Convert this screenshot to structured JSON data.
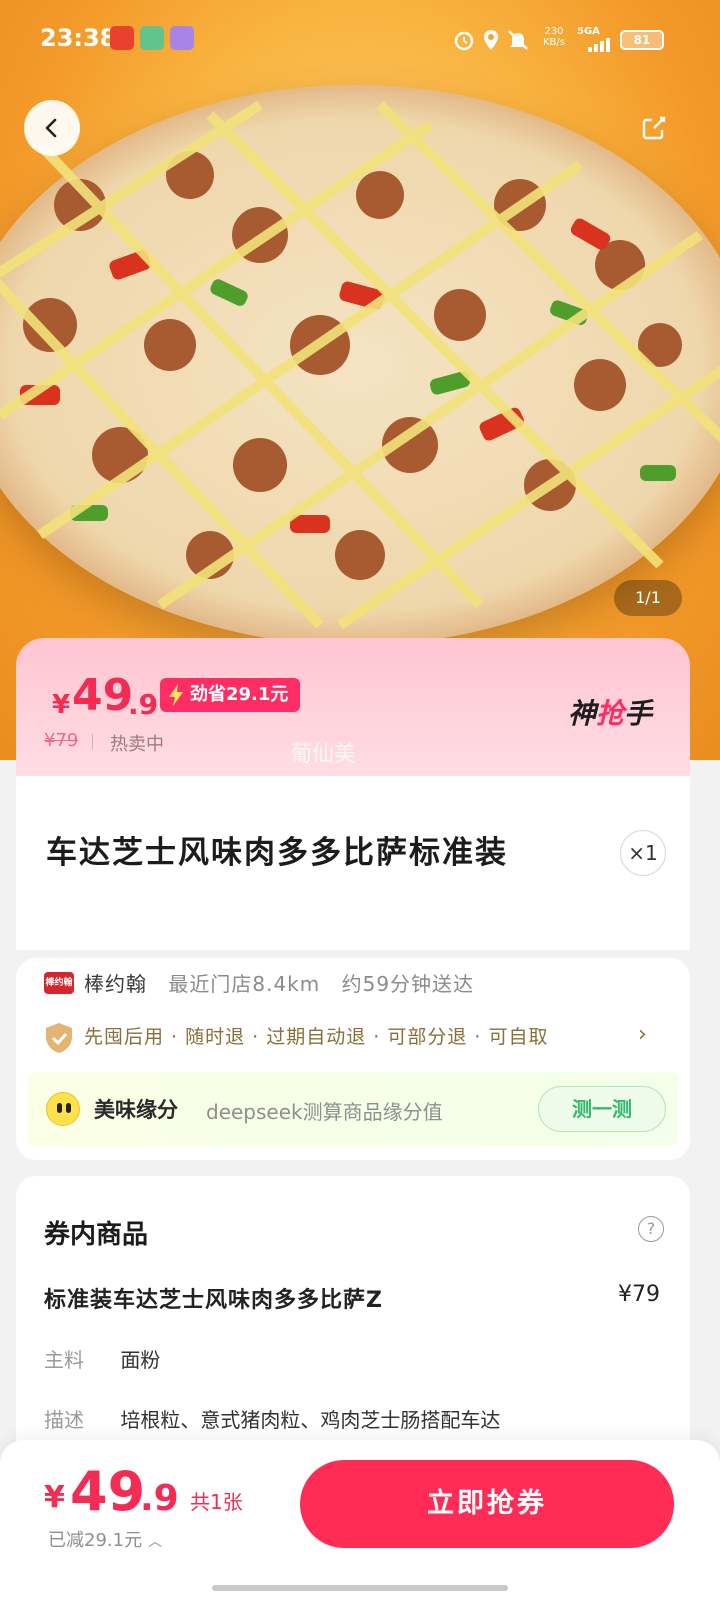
{
  "status_bar": {
    "time": "23:38",
    "net_speed": "230",
    "net_unit": "KB/s",
    "signal": "5GA",
    "battery": "81"
  },
  "hero": {
    "pager": "1/1"
  },
  "price": {
    "currency": "¥",
    "int": "49",
    "dec": ".9",
    "drop_label": "劲省29.1元",
    "original": "¥79",
    "hot": "热卖中",
    "brand_a": "神",
    "brand_b": "抢",
    "brand_c": "手",
    "watermark": "葡仙美"
  },
  "product": {
    "title": "车达芝士风味肉多多比萨标准装",
    "qty": "×1"
  },
  "store": {
    "logo": "棒约翰",
    "name": "棒约翰",
    "nearest": "最近门店8.4km",
    "delivery": "约59分钟送达",
    "policy": "先囤后用 · 随时退 · 过期自动退 · 可部分退 · 可自取"
  },
  "match": {
    "title": "美味缘分",
    "desc": "deepseek测算商品缘分值",
    "button": "测一测"
  },
  "goods": {
    "title": "券内商品",
    "help": "?",
    "item_name": "标准装车达芝士风味肉多多比萨Z",
    "item_price": "¥79",
    "ingredient_label": "主料",
    "ingredient_value": "面粉",
    "desc_label": "描述",
    "desc_value": "培根粒、意式猪肉粒、鸡肉芝士肠搭配车达"
  },
  "bottom": {
    "currency": "¥",
    "int": "49",
    "dec": ".9",
    "count": "共1张",
    "saved": "已减29.1元",
    "buy": "立即抢券"
  },
  "colors": {
    "accent": "#ff2d55",
    "price": "#f42b53",
    "match_green": "#37b86e"
  },
  "icons": [
    "back-arrow-icon",
    "share-icon",
    "bolt-icon",
    "shield-icon",
    "emoji-face-icon",
    "help-icon",
    "chevron-right-icon",
    "chevron-up-icon",
    "alarm-icon",
    "location-icon",
    "mute-icon"
  ]
}
